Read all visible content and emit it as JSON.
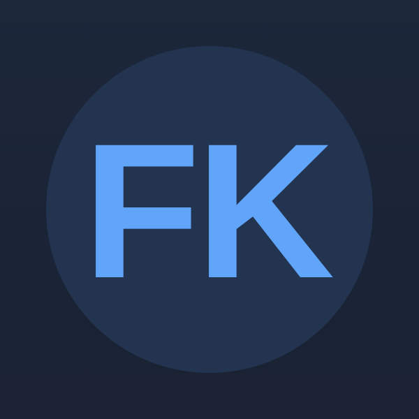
{
  "avatar": {
    "initials": "FK",
    "colors": {
      "background": "#1c273a",
      "circle": "#22344f",
      "text": "#60a5fa"
    }
  }
}
